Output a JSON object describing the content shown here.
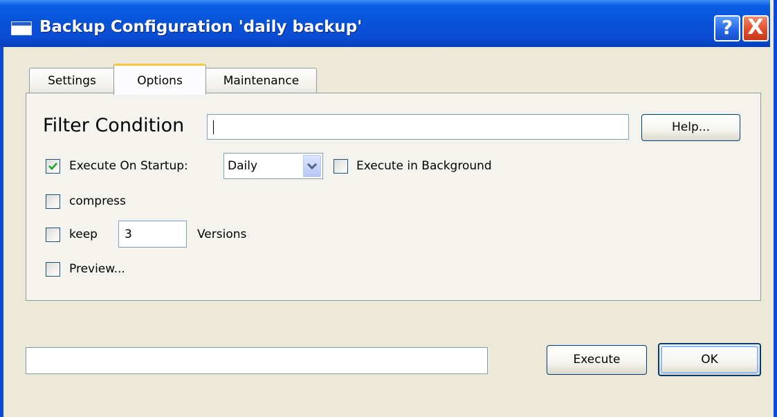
{
  "window": {
    "title": "Backup Configuration 'daily backup'",
    "help_glyph": "?",
    "close_glyph": "X"
  },
  "tabs": [
    {
      "label": "Settings",
      "selected": false
    },
    {
      "label": "Options",
      "selected": true
    },
    {
      "label": "Maintenance",
      "selected": false
    }
  ],
  "options": {
    "filter_label": "Filter Condition",
    "filter_value": "",
    "help_button": "Help...",
    "execute_on_startup": {
      "label": "Execute On Startup:",
      "checked": true
    },
    "frequency": {
      "selected": "Daily"
    },
    "execute_background": {
      "label": "Execute in Background",
      "checked": false
    },
    "compress": {
      "label": "compress",
      "checked": false
    },
    "keep": {
      "label": "keep",
      "checked": false,
      "value": "3",
      "suffix": "Versions"
    },
    "preview": {
      "label": "Preview...",
      "checked": false
    }
  },
  "footer": {
    "status_value": "",
    "execute_button": "Execute",
    "ok_button": "OK"
  },
  "icons": {
    "app": "window-icon",
    "help": "help-icon",
    "close": "close-icon",
    "check": "checkmark-icon",
    "dropdown": "chevron-down-icon"
  },
  "colors": {
    "titlebar": "#0a53d8",
    "dialog_bg": "#ece9d8",
    "selected_tab_accent": "#ffc83c",
    "checkmark": "#21a121"
  }
}
